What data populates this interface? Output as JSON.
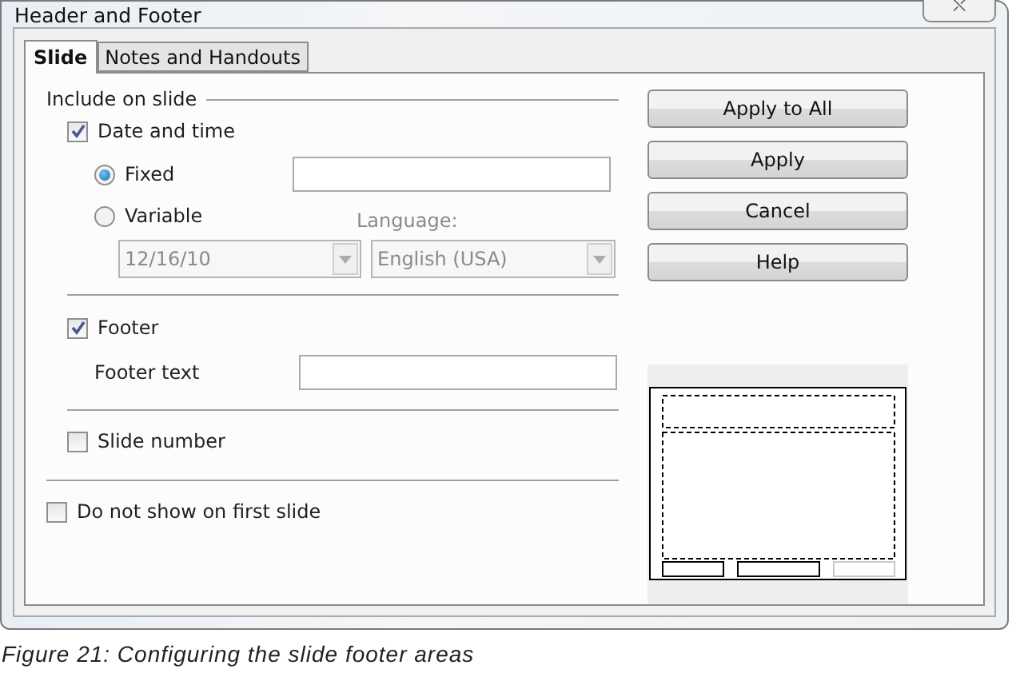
{
  "window": {
    "title": "Header and Footer",
    "close_icon": "⛌"
  },
  "tabs": [
    {
      "label": "Slide",
      "selected": true
    },
    {
      "label": "Notes and Handouts",
      "selected": false
    }
  ],
  "include_group": {
    "title": "Include on slide"
  },
  "date_time": {
    "label": "Date and time",
    "checked": true
  },
  "date_modes": [
    {
      "label": "Fixed",
      "selected": true
    },
    {
      "label": "Variable",
      "selected": false
    }
  ],
  "language_label": {
    "label": "Language:",
    "disabled": true
  },
  "date_format": {
    "value": "12/16/10",
    "disabled": true
  },
  "language": {
    "value": "English (USA)",
    "disabled": true
  },
  "footer": {
    "label": "Footer",
    "checked": true
  },
  "footer_text": {
    "label": "Footer text"
  },
  "slide_number": {
    "label": "Slide number",
    "checked": false
  },
  "not_first": {
    "label": "Do not show on first slide",
    "checked": false
  },
  "buttons": [
    "Apply to All",
    "Apply",
    "Cancel",
    "Help"
  ],
  "caption": "Figure 21: Configuring the slide footer areas"
}
